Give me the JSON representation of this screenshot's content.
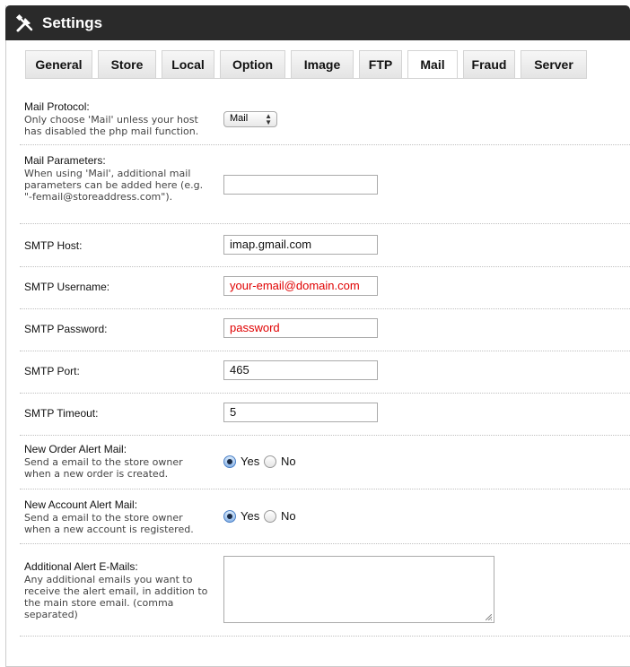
{
  "header": {
    "title": "Settings",
    "icon": "tools-icon"
  },
  "tabs": [
    {
      "label": "General"
    },
    {
      "label": "Store"
    },
    {
      "label": "Local"
    },
    {
      "label": "Option"
    },
    {
      "label": "Image"
    },
    {
      "label": "FTP"
    },
    {
      "label": "Mail"
    },
    {
      "label": "Fraud"
    },
    {
      "label": "Server"
    }
  ],
  "active_tab": "Mail",
  "form": {
    "mail_protocol": {
      "label": "Mail Protocol:",
      "help": "Only choose 'Mail' unless your host has disabled the php mail function.",
      "value": "Mail"
    },
    "mail_parameters": {
      "label": "Mail Parameters:",
      "help": "When using 'Mail', additional mail parameters can be added here (e.g. \"-femail@storeaddress.com\").",
      "value": ""
    },
    "smtp_host": {
      "label": "SMTP Host:",
      "value": "imap.gmail.com"
    },
    "smtp_username": {
      "label": "SMTP Username:",
      "value": "your-email@domain.com"
    },
    "smtp_password": {
      "label": "SMTP Password:",
      "value": "password"
    },
    "smtp_port": {
      "label": "SMTP Port:",
      "value": "465"
    },
    "smtp_timeout": {
      "label": "SMTP Timeout:",
      "value": "5"
    },
    "new_order_alert": {
      "label": "New Order Alert Mail:",
      "help": "Send a email to the store owner when a new order is created.",
      "yes": "Yes",
      "no": "No",
      "selected": "Yes"
    },
    "new_account_alert": {
      "label": "New Account Alert Mail:",
      "help": "Send a email to the store owner when a new account is registered.",
      "yes": "Yes",
      "no": "No",
      "selected": "Yes"
    },
    "additional_alert_emails": {
      "label": "Additional Alert E-Mails:",
      "help": "Any additional emails you want to receive the alert email, in addition to the main store email. (comma separated)",
      "value": ""
    }
  },
  "colors": {
    "header_bg": "#2a2a2a",
    "highlight_text": "#e00000"
  }
}
